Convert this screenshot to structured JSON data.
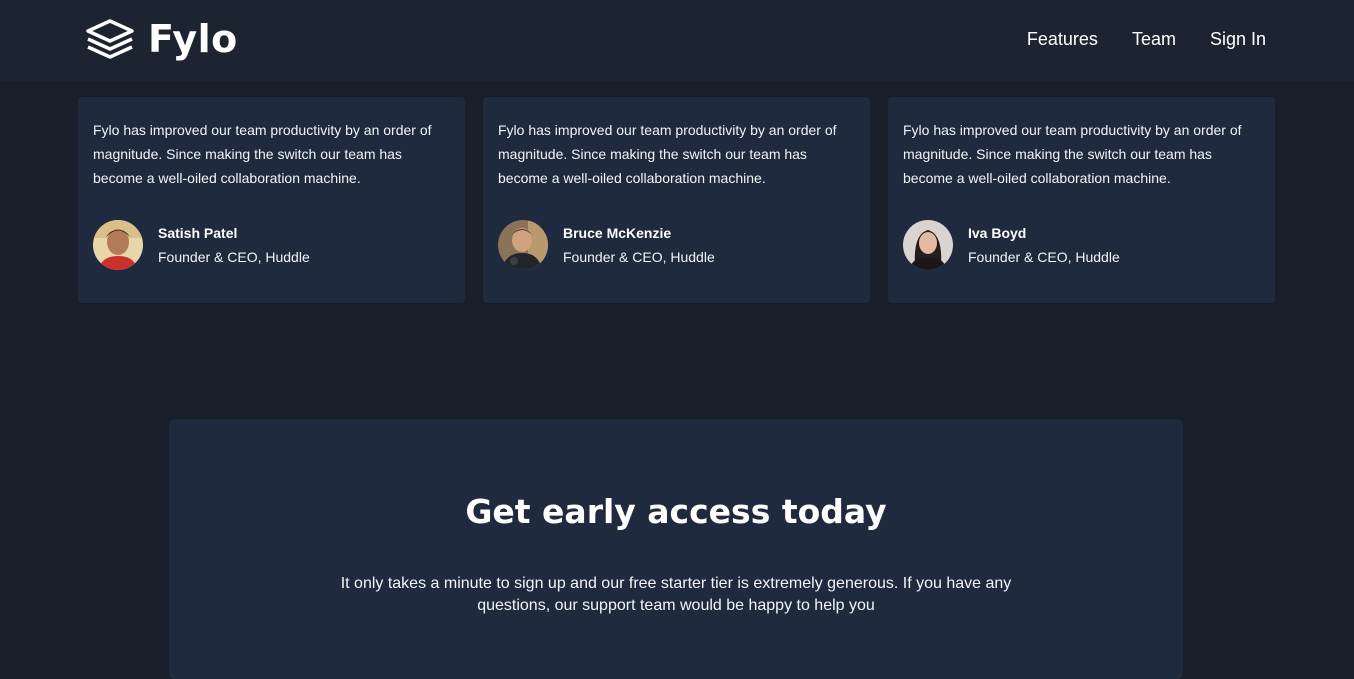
{
  "brand": {
    "name": "Fylo",
    "logo_icon": "stacked-layers-icon"
  },
  "nav": {
    "links": [
      "Features",
      "Team",
      "Sign In"
    ]
  },
  "testimonials": [
    {
      "quote": "Fylo has improved our team productivity by an order of magnitude. Since making the switch our team has become a well-oiled collaboration machine.",
      "name": "Satish Patel",
      "role": "Founder & CEO, Huddle"
    },
    {
      "quote": "Fylo has improved our team productivity by an order of magnitude. Since making the switch our team has become a well-oiled collaboration machine.",
      "name": "Bruce McKenzie",
      "role": "Founder & CEO, Huddle"
    },
    {
      "quote": "Fylo has improved our team productivity by an order of magnitude. Since making the switch our team has become a well-oiled collaboration machine.",
      "name": "Iva Boyd",
      "role": "Founder & CEO, Huddle"
    }
  ],
  "cta": {
    "title": "Get early access today",
    "text": "It only takes a minute to sign up and our free starter tier is extremely generous. If you have any questions, our support team would be happy to help you"
  },
  "colors": {
    "page_background": "#181f2a",
    "nav_background": "#1c2331",
    "card_background": "#1f2a3f",
    "text": "#ffffff"
  }
}
